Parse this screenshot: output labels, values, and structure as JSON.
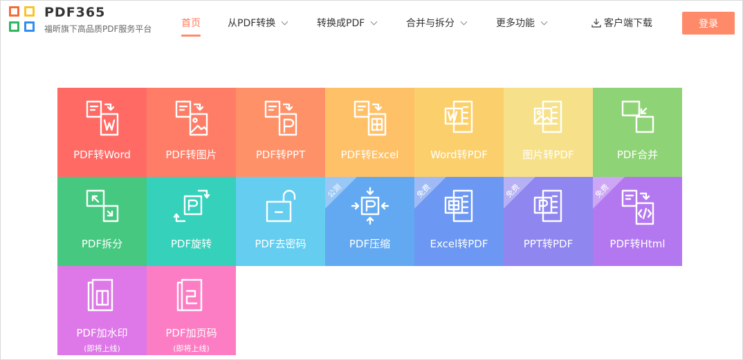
{
  "header": {
    "brand": "PDF365",
    "slogan": "福昕旗下高品质PDF服务平台",
    "logo_colors": [
      "#f26b3a",
      "#f7c52b",
      "#2fb55e",
      "#2d8df0"
    ],
    "nav": [
      {
        "label": "首页",
        "active": true,
        "dropdown": false
      },
      {
        "label": "从PDF转换",
        "active": false,
        "dropdown": true
      },
      {
        "label": "转换成PDF",
        "active": false,
        "dropdown": true
      },
      {
        "label": "合并与拆分",
        "active": false,
        "dropdown": true
      },
      {
        "label": "更多功能",
        "active": false,
        "dropdown": true
      }
    ],
    "download_label": "客户端下载",
    "download_icon": "download-icon",
    "login_label": "登录",
    "accent_color": "#ff8a6a"
  },
  "tools": [
    {
      "label": "PDF转Word",
      "color": "#ff6a65",
      "icon": "pdf-to-word-icon"
    },
    {
      "label": "PDF转图片",
      "color": "#ff7d67",
      "icon": "pdf-to-image-icon"
    },
    {
      "label": "PDF转PPT",
      "color": "#ff9168",
      "icon": "pdf-to-ppt-icon"
    },
    {
      "label": "PDF转Excel",
      "color": "#ffc168",
      "icon": "pdf-to-excel-icon"
    },
    {
      "label": "Word转PDF",
      "color": "#fbd06c",
      "icon": "word-to-pdf-icon"
    },
    {
      "label": "图片转PDF",
      "color": "#f6e18a",
      "icon": "image-to-pdf-icon"
    },
    {
      "label": "PDF合并",
      "color": "#8fd377",
      "icon": "pdf-merge-icon"
    },
    {
      "label": "PDF拆分",
      "color": "#46c880",
      "icon": "pdf-split-icon"
    },
    {
      "label": "PDF旋转",
      "color": "#35d1bb",
      "icon": "pdf-rotate-icon"
    },
    {
      "label": "PDF去密码",
      "color": "#64cdf0",
      "icon": "unlock-icon"
    },
    {
      "label": "PDF压缩",
      "color": "#63a9f1",
      "icon": "pdf-compress-icon",
      "badge": "公测"
    },
    {
      "label": "Excel转PDF",
      "color": "#6c97f2",
      "icon": "excel-to-pdf-icon",
      "badge": "免费"
    },
    {
      "label": "PPT转PDF",
      "color": "#8f86f0",
      "icon": "ppt-to-pdf-icon",
      "badge": "免费"
    },
    {
      "label": "PDF转Html",
      "color": "#b378f0",
      "icon": "pdf-to-html-icon",
      "badge": "免费"
    },
    {
      "label": "PDF加水印",
      "color": "#de78e8",
      "icon": "watermark-icon",
      "sub": "(即将上线)"
    },
    {
      "label": "PDF加页码",
      "color": "#fc7dc3",
      "icon": "page-number-icon",
      "sub": "(即将上线)"
    }
  ]
}
